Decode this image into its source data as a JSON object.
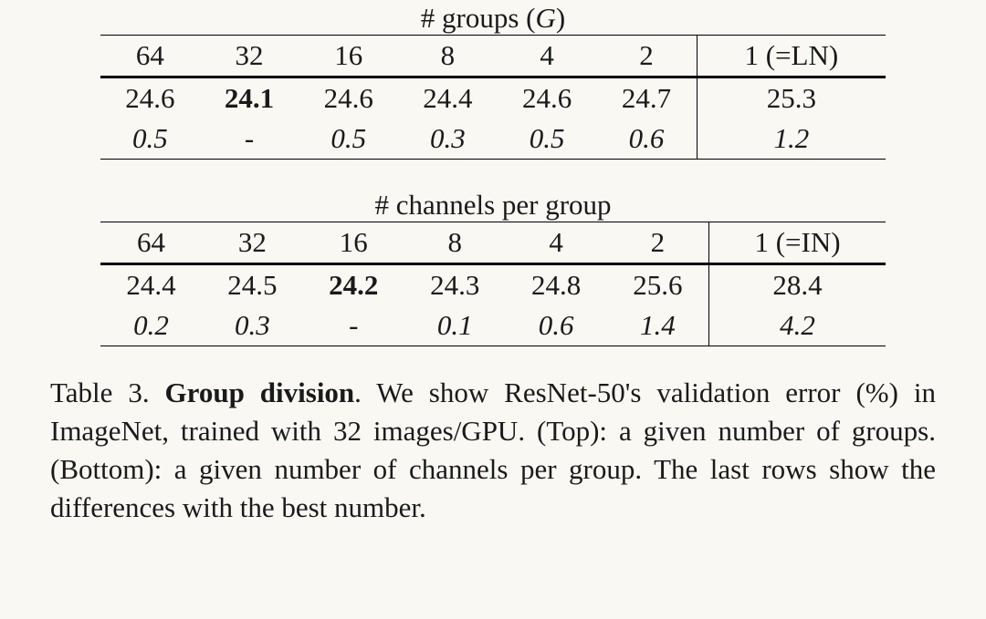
{
  "chart_data": [
    {
      "type": "table",
      "title": "# groups (G)",
      "columns": [
        "64",
        "32",
        "16",
        "8",
        "4",
        "2",
        "1 (=LN)"
      ],
      "rows": [
        {
          "cells": [
            "24.6",
            "24.1",
            "24.6",
            "24.4",
            "24.6",
            "24.7",
            "25.3"
          ]
        },
        {
          "cells": [
            "0.5",
            "-",
            "0.5",
            "0.3",
            "0.5",
            "0.6",
            "1.2"
          ]
        }
      ],
      "bold_cell": [
        0,
        1
      ],
      "row_styles": [
        "normal",
        "italic"
      ]
    },
    {
      "type": "table",
      "title": "# channels per group",
      "columns": [
        "64",
        "32",
        "16",
        "8",
        "4",
        "2",
        "1 (=IN)"
      ],
      "rows": [
        {
          "cells": [
            "24.4",
            "24.5",
            "24.2",
            "24.3",
            "24.8",
            "25.6",
            "28.4"
          ]
        },
        {
          "cells": [
            "0.2",
            "0.3",
            "-",
            "0.1",
            "0.6",
            "1.4",
            "4.2"
          ]
        }
      ],
      "bold_cell": [
        0,
        2
      ],
      "row_styles": [
        "normal",
        "italic"
      ]
    }
  ],
  "table1": {
    "title_prefix": "# groups (",
    "g_letter": "G",
    "title_suffix": ")",
    "headers": [
      "64",
      "32",
      "16",
      "8",
      "4",
      "2",
      "1 (=LN)"
    ],
    "data": [
      "24.6",
      "24.1",
      "24.6",
      "24.4",
      "24.6",
      "24.7",
      "25.3"
    ],
    "diff": [
      "0.5",
      "-",
      "0.5",
      "0.3",
      "0.5",
      "0.6",
      "1.2"
    ]
  },
  "table2": {
    "title": "# channels per group",
    "headers": [
      "64",
      "32",
      "16",
      "8",
      "4",
      "2",
      "1 (=IN)"
    ],
    "data": [
      "24.4",
      "24.5",
      "24.2",
      "24.3",
      "24.8",
      "25.6",
      "28.4"
    ],
    "diff": [
      "0.2",
      "0.3",
      "-",
      "0.1",
      "0.6",
      "1.4",
      "4.2"
    ]
  },
  "caption": {
    "lead": "Table 3. ",
    "title": "Group division",
    "rest": ". We show ResNet-50's validation error (%) in ImageNet, trained with 32 images/GPU. (Top): a given number of groups. (Bottom): a given number of channels per group. The last rows show the differences with the best number."
  }
}
